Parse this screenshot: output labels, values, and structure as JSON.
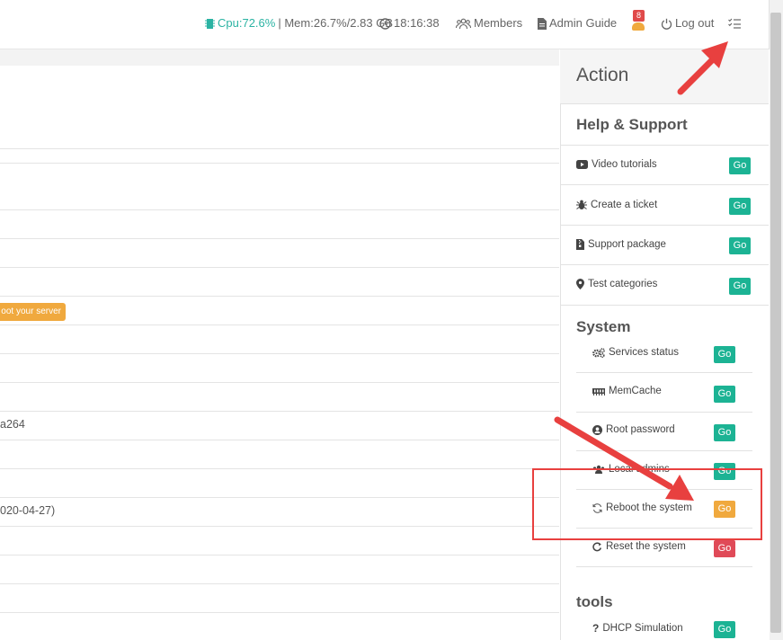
{
  "topbar": {
    "cpu_label": "Cpu:",
    "cpu_value": "72.6%",
    "mem_text": "| Mem:26.7%/2.83 GB",
    "time": "18:16:38",
    "members": "Members",
    "admin_guide": "Admin Guide",
    "notif_count": "8",
    "logout": "Log out"
  },
  "main": {
    "reboot_notice": "oot your server",
    "row_text_1": "a264",
    "row_text_2": "020-04-27)"
  },
  "panel": {
    "title": "Action",
    "help_title": "Help & Support",
    "help_items": [
      {
        "label": "Video tutorials",
        "go": "Go"
      },
      {
        "label": "Create a ticket",
        "go": "Go"
      },
      {
        "label": "Support package",
        "go": "Go"
      },
      {
        "label": "Test categories",
        "go": "Go"
      }
    ],
    "system_title": "System",
    "system_items": [
      {
        "label": "Services status",
        "go": "Go"
      },
      {
        "label": "MemCache",
        "go": "Go"
      },
      {
        "label": "Root password",
        "go": "Go"
      },
      {
        "label": "Local admins",
        "go": "Go"
      },
      {
        "label": "Reboot the system",
        "go": "Go"
      },
      {
        "label": "Reset the system",
        "go": "Go"
      }
    ],
    "tools_title": "tools",
    "tools_items": [
      {
        "label": "DHCP Simulation",
        "go": "Go"
      }
    ]
  },
  "colors": {
    "accent_green": "#1cb394",
    "warning_orange": "#f0a93e",
    "danger_red": "#e04a58",
    "annotation_red": "#e8403f"
  }
}
